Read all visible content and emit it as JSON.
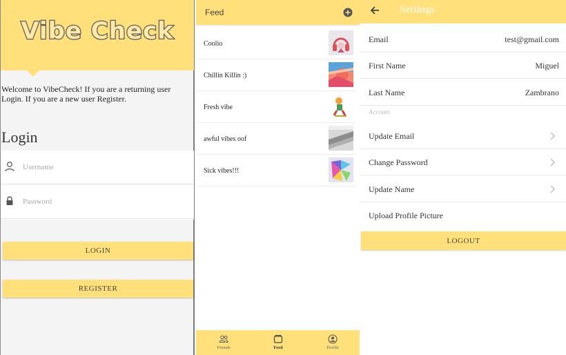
{
  "login": {
    "logo_text": "Vibe Check",
    "welcome_text": "Welcome to VibeCheck! If you are a returning user Login. If you are a new user Register.",
    "title": "Login",
    "username_placeholder": "Username",
    "password_placeholder": "Password",
    "login_label": "LOGIN",
    "register_label": "REGISTER",
    "username_icon": "user-icon",
    "password_icon": "lock-icon"
  },
  "feed": {
    "title": "Feed",
    "add_icon": "add-circle-icon",
    "items": [
      {
        "label": "Coolio",
        "thumb": "headphones-art"
      },
      {
        "label": "Chillin Killin :)",
        "thumb": "sunset-art"
      },
      {
        "label": "Fresh vibe",
        "thumb": "cartoon-art"
      },
      {
        "label": "awful vibes oof",
        "thumb": "gray-stripes-art"
      },
      {
        "label": "Sick vibes!!!",
        "thumb": "colorful-art"
      }
    ],
    "nav": [
      {
        "label": "Friends",
        "icon": "friends-icon",
        "active": false
      },
      {
        "label": "Feed",
        "icon": "feed-icon",
        "active": true
      },
      {
        "label": "Profile",
        "icon": "profile-icon",
        "active": false
      }
    ]
  },
  "settings": {
    "title": "Settings",
    "back_icon": "arrow-left-icon",
    "email_label": "Email",
    "email_value": "test@gmail.com",
    "first_name_label": "First Name",
    "first_name_value": "Miguel",
    "last_name_label": "Last Name",
    "last_name_value": "Zambrano",
    "section_label": "Account",
    "update_email": "Update Email",
    "change_password": "Change Password",
    "update_name": "Update Name",
    "upload_picture": "Upload Profile Picture",
    "logout_label": "LOGOUT"
  },
  "colors": {
    "accent": "#ffe07a",
    "background": "#f4f4f4"
  }
}
